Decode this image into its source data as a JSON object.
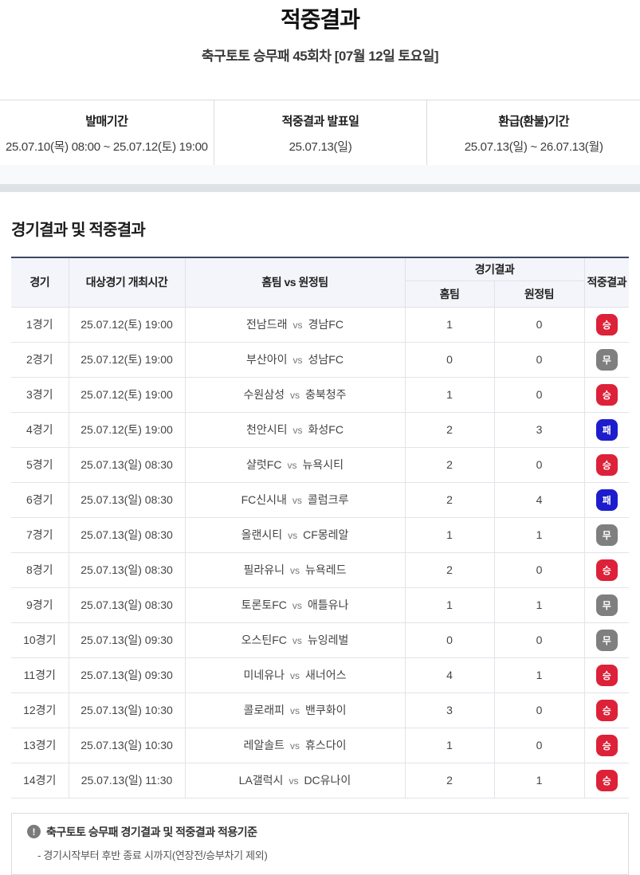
{
  "page": {
    "title": "적중결과",
    "subtitle": "축구토토 승무패 45회차 [07월 12일 토요일]"
  },
  "info": {
    "items": [
      {
        "label": "발매기간",
        "value": "25.07.10(목) 08:00 ~ 25.07.12(토) 19:00"
      },
      {
        "label": "적중결과 발표일",
        "value": "25.07.13(일)"
      },
      {
        "label": "환급(환불)기간",
        "value": "25.07.13(일) ~ 26.07.13(월)"
      }
    ]
  },
  "results_section": {
    "heading": "경기결과 및 적중결과",
    "table": {
      "headers": {
        "match": "경기",
        "datetime": "대상경기 개최시간",
        "teams": "홈팀 vs 원정팀",
        "match_result": "경기결과",
        "home": "홈팀",
        "away": "원정팀",
        "hit_result": "적중결과"
      },
      "vs_label": "vs",
      "rows": [
        {
          "match": "1경기",
          "datetime": "25.07.12(토) 19:00",
          "home_team": "전남드래",
          "away_team": "경남FC",
          "home_score": "1",
          "away_score": "0",
          "result": "승"
        },
        {
          "match": "2경기",
          "datetime": "25.07.12(토) 19:00",
          "home_team": "부산아이",
          "away_team": "성남FC",
          "home_score": "0",
          "away_score": "0",
          "result": "무"
        },
        {
          "match": "3경기",
          "datetime": "25.07.12(토) 19:00",
          "home_team": "수원삼성",
          "away_team": "충북청주",
          "home_score": "1",
          "away_score": "0",
          "result": "승"
        },
        {
          "match": "4경기",
          "datetime": "25.07.12(토) 19:00",
          "home_team": "천안시티",
          "away_team": "화성FC",
          "home_score": "2",
          "away_score": "3",
          "result": "패"
        },
        {
          "match": "5경기",
          "datetime": "25.07.13(일) 08:30",
          "home_team": "샬럿FC",
          "away_team": "뉴욕시티",
          "home_score": "2",
          "away_score": "0",
          "result": "승"
        },
        {
          "match": "6경기",
          "datetime": "25.07.13(일) 08:30",
          "home_team": "FC신시내",
          "away_team": "콜럼크루",
          "home_score": "2",
          "away_score": "4",
          "result": "패"
        },
        {
          "match": "7경기",
          "datetime": "25.07.13(일) 08:30",
          "home_team": "올랜시티",
          "away_team": "CF몽레알",
          "home_score": "1",
          "away_score": "1",
          "result": "무"
        },
        {
          "match": "8경기",
          "datetime": "25.07.13(일) 08:30",
          "home_team": "필라유니",
          "away_team": "뉴욕레드",
          "home_score": "2",
          "away_score": "0",
          "result": "승"
        },
        {
          "match": "9경기",
          "datetime": "25.07.13(일) 08:30",
          "home_team": "토론토FC",
          "away_team": "애틀유나",
          "home_score": "1",
          "away_score": "1",
          "result": "무"
        },
        {
          "match": "10경기",
          "datetime": "25.07.13(일) 09:30",
          "home_team": "오스틴FC",
          "away_team": "뉴잉레벌",
          "home_score": "0",
          "away_score": "0",
          "result": "무"
        },
        {
          "match": "11경기",
          "datetime": "25.07.13(일) 09:30",
          "home_team": "미네유나",
          "away_team": "새너어스",
          "home_score": "4",
          "away_score": "1",
          "result": "승"
        },
        {
          "match": "12경기",
          "datetime": "25.07.13(일) 10:30",
          "home_team": "콜로래피",
          "away_team": "밴쿠화이",
          "home_score": "3",
          "away_score": "0",
          "result": "승"
        },
        {
          "match": "13경기",
          "datetime": "25.07.13(일) 10:30",
          "home_team": "레알솔트",
          "away_team": "휴스다이",
          "home_score": "1",
          "away_score": "0",
          "result": "승"
        },
        {
          "match": "14경기",
          "datetime": "25.07.13(일) 11:30",
          "home_team": "LA갤럭시",
          "away_team": "DC유나이",
          "home_score": "2",
          "away_score": "1",
          "result": "승"
        }
      ]
    },
    "result_badge_colors": {
      "승": "#dc2139",
      "무": "#7f7f7f",
      "패": "#1d1dcd"
    }
  },
  "note": {
    "title": "축구토토 승무패 경기결과 및 적중결과 적용기준",
    "line": "- 경기시작부터 후반 종료 시까지(연장전/승부차기 제외)",
    "icon_glyph": "!"
  }
}
